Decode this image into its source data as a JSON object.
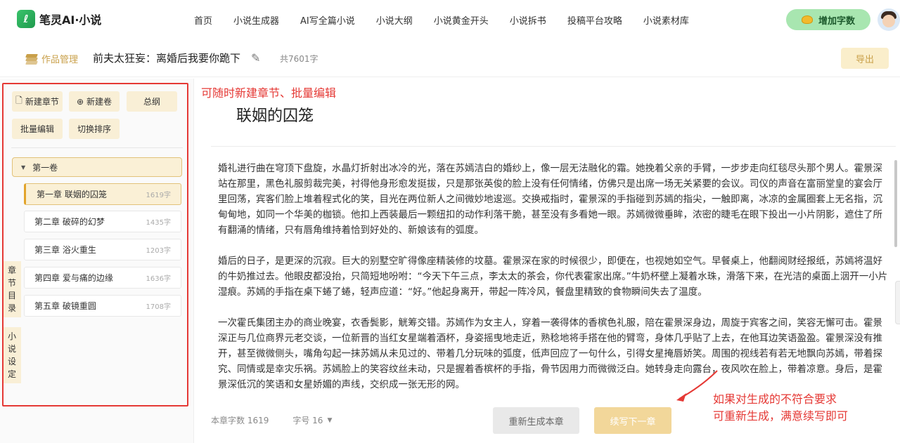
{
  "topbar": {
    "logo_text": "笔灵AI·小说",
    "nav": [
      "首页",
      "小说生成器",
      "AI写全篇小说",
      "小说大纲",
      "小说黄金开头",
      "小说拆书",
      "投稿平台攻略",
      "小说素材库"
    ],
    "add_words_label": "增加字数"
  },
  "subbar": {
    "works_label": "作品管理",
    "book_title": "前夫太狂妄：离婚后我要你跪下",
    "word_total": "共7601字",
    "export_label": "导出"
  },
  "sidebar": {
    "tools": [
      "新建章节",
      "新建卷",
      "总纲",
      "批量编辑",
      "切换排序"
    ],
    "volume": "第一卷",
    "chapters": [
      {
        "label": "第一章 联姻的囚笼",
        "count": "1619字"
      },
      {
        "label": "第二章 破碎的幻梦",
        "count": "1435字"
      },
      {
        "label": "第三章 浴火重生",
        "count": "1203字"
      },
      {
        "label": "第四章 爱与痛的边缘",
        "count": "1636字"
      },
      {
        "label": "第五章 破镜重圆",
        "count": "1708字"
      }
    ],
    "tab_chapters": [
      "章",
      "节",
      "目",
      "录"
    ],
    "tab_settings": [
      "小",
      "说",
      "设",
      "定"
    ]
  },
  "annotations": {
    "top": "可随时新建章节、批量编辑",
    "bottom_1": "如果对生成的不符合要求",
    "bottom_2": "可重新生成，满意续写即可"
  },
  "main": {
    "chapter_title": "联姻的囚笼",
    "paragraphs": [
      "婚礼进行曲在穹顶下盘旋，水晶灯折射出冰冷的光，落在苏嫣洁白的婚纱上，像一层无法融化的霜。她挽着父亲的手臂，一步步走向红毯尽头那个男人。霍景深站在那里，黑色礼服剪裁完美，衬得他身形愈发挺拔，只是那张英俊的脸上没有任何情绪，仿佛只是出席一场无关紧要的会议。司仪的声音在富丽堂皇的宴会厅里回荡，宾客们脸上堆着程式化的笑，目光在两位新人之间微妙地逡巡。交换戒指时，霍景深的手指碰到苏嫣的指尖，一触即离，冰凉的金属圈套上无名指，沉甸甸地，如同一个华美的枷锁。他扣上西装最后一颗纽扣的动作利落干脆，甚至没有多看她一眼。苏嫣微微垂眸，浓密的睫毛在眼下投出一小片阴影，遮住了所有翻涌的情绪，只有唇角维持着恰到好处的、新娘该有的弧度。",
      "婚后的日子，是更深的沉寂。巨大的别墅空旷得像座精装修的坟墓。霍景深在家的时候很少，即便在，也视她如空气。早餐桌上，他翻阅财经报纸，苏嫣将温好的牛奶推过去。他眼皮都没抬，只简短地吩咐：“今天下午三点，李太太的茶会，你代表霍家出席。”牛奶杯壁上凝着水珠，滑落下来，在光洁的桌面上洇开一小片湿痕。苏嫣的手指在桌下蜷了蜷，轻声应道：“好。”他起身离开，带起一阵冷风，餐盘里精致的食物瞬间失去了温度。",
      "一次霍氏集团主办的商业晚宴，衣香鬓影，觥筹交错。苏嫣作为女主人，穿着一袭得体的香槟色礼服，陪在霍景深身边，周旋于宾客之间，笑容无懈可击。霍景深正与几位商界元老交谈，一位新晋的当红女星端着酒杯，身姿摇曳地走近，熟稔地将手搭在他的臂弯，身体几乎贴了上去，在他耳边笑语盈盈。霍景深没有推开，甚至微微侧头，嘴角勾起一抹苏嫣从未见过的、带着几分玩味的弧度，低声回应了一句什么，引得女星掩唇娇笑。周围的视线若有若无地飘向苏嫣，带着探究、同情或是幸灾乐祸。苏嫣脸上的笑容纹丝未动，只是握着香槟杯的手指，骨节因用力而微微泛白。她转身走向露台，夜风吹在脸上，带着凉意。身后，是霍景深低沉的笑语和女星娇媚的声线，交织成一张无形的网。"
    ],
    "chapter_word_count": "本章字数 1619",
    "font_size": "字号 16",
    "regen_label": "重新生成本章",
    "continue_label": "续写下一章"
  },
  "colors": {
    "accent_gold": "#e2a42b",
    "annotation_red": "#e53935",
    "brand_green": "#2fb25a"
  }
}
